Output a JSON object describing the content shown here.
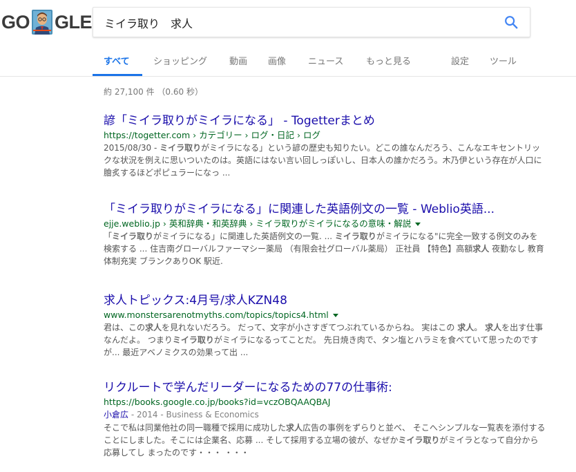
{
  "logo": {
    "left": "GO",
    "right": "GLE"
  },
  "search": {
    "query": "ミイラ取り　求人",
    "button_icon": "search-icon"
  },
  "tabs": [
    {
      "label": "すべて",
      "active": true
    },
    {
      "label": "ショッピング"
    },
    {
      "label": "動画"
    },
    {
      "label": "画像"
    },
    {
      "label": "ニュース"
    },
    {
      "label": "もっと見る"
    },
    {
      "label": "設定"
    },
    {
      "label": "ツール"
    }
  ],
  "stats": "約 27,100 件 （0.60 秒）",
  "results": [
    {
      "title": "諺「ミイラ取りがミイラになる」 - Togetterまとめ",
      "url": "https://togetter.com › カテゴリー › ログ・日記 › ログ",
      "has_arrow": false,
      "snippet": [
        {
          "t": "2015/08/30 - "
        },
        {
          "t": "ミイラ取り",
          "b": true
        },
        {
          "t": "がミイラになる」という諺の歴史も知りたい。どこの誰なんだろう、こんなエキセントリックな状況を例えに思いついたのは。英語にはない言い回しっぽいし、日本人の誰かだろう。木乃伊という存在が人口に膾炙するほどポピュラーになっ ..."
        }
      ]
    },
    {
      "title": "「ミイラ取りがミイラになる」に関連した英語例文の一覧 - Weblio英語...",
      "url": "ejje.weblio.jp › 英和辞典・和英辞典 › ミイラ取りがミイラになるの意味・解説",
      "has_arrow": true,
      "snippet": [
        {
          "t": "「"
        },
        {
          "t": "ミイラ取り",
          "b": true
        },
        {
          "t": "がミイラになる」に関連した英語例文の一覧. ... "
        },
        {
          "t": "ミイラ取り",
          "b": true
        },
        {
          "t": "がミイラになる\"に完全一致する例文のみを検索する ... 住吉南グローバルファーマシー薬局 （有限会社グローバル薬局） 正社員 【特色】高額"
        },
        {
          "t": "求人",
          "b": true
        },
        {
          "t": " 夜勤なし 教育体制充実 ブランクありOK 駅近."
        }
      ]
    },
    {
      "title": "求人トピックス:4月号/求人KZN48",
      "url": "www.monstersarenotmyths.com/topics/topics4.html",
      "has_arrow": true,
      "snippet": [
        {
          "t": "君は、この"
        },
        {
          "t": "求人",
          "b": true
        },
        {
          "t": "を見れないだろう。 だって、文字が小さすぎてつぶれているからね。 実はこの "
        },
        {
          "t": "求人",
          "b": true
        },
        {
          "t": "。 "
        },
        {
          "t": "求人",
          "b": true
        },
        {
          "t": "を出す仕事なんだよ。 つまり"
        },
        {
          "t": "ミイラ取り",
          "b": true
        },
        {
          "t": "がミイラになるってことだ。 先日焼き肉で、タン塩とハラミを食べていて思ったのですが... 最近アベノミクスの効果って出 ..."
        }
      ]
    },
    {
      "title": "リクルートで学んだリーダーになるための77の仕事術:",
      "url": "https://books.google.co.jp/books?id=vczOBQAAQBAJ",
      "has_arrow": false,
      "meta": {
        "author": "小倉広",
        "rest": " - 2014 - Business & Economics"
      },
      "snippet": [
        {
          "t": "そこで私は同業他社の同一職種で採用に成功した"
        },
        {
          "t": "求人",
          "b": true
        },
        {
          "t": "広告の事例をずらりと並べ、 そこへシンプルな一覧表を添付することにしました。そこには企業名、応募 ... そして採用する立場の彼が、なぜか"
        },
        {
          "t": "ミイラ取り",
          "b": true
        },
        {
          "t": "がミイラとなって自分から応募してし まったのです・・・ ・・・"
        }
      ]
    }
  ],
  "colors": {
    "link": "#1a0dab",
    "url": "#006621",
    "accent": "#1a73e8",
    "snippet": "#545454"
  }
}
